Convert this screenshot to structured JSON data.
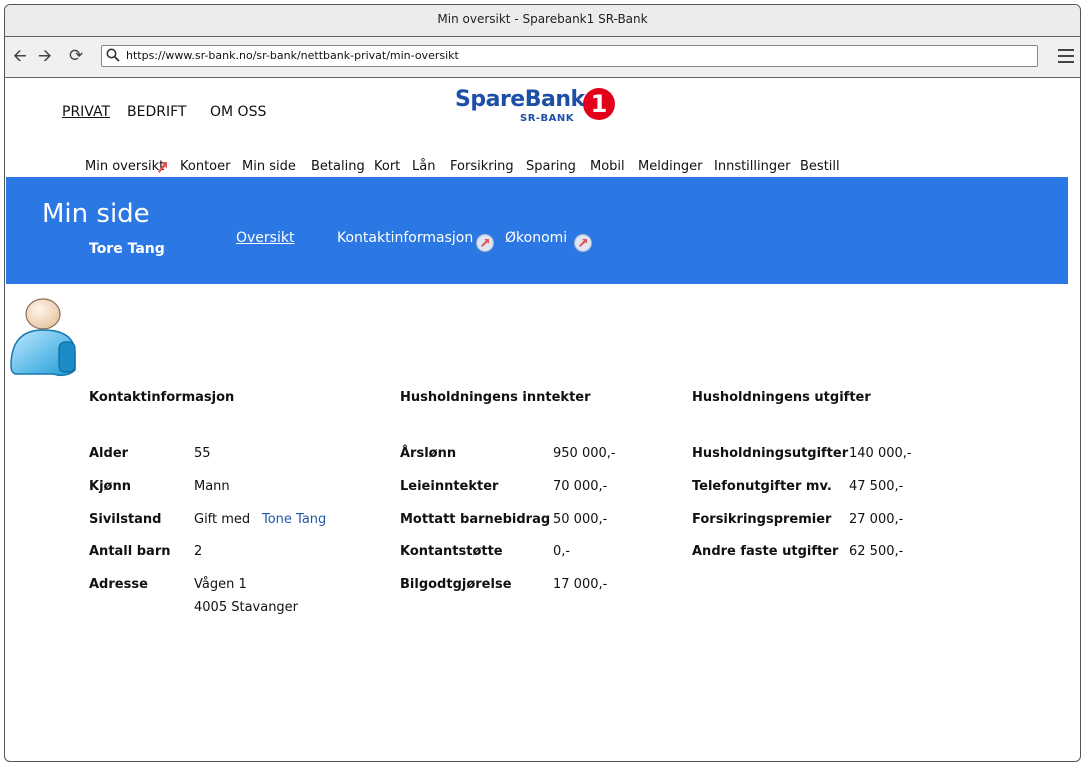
{
  "window": {
    "title": "Min oversikt - Sparebank1 SR-Bank"
  },
  "browser": {
    "url": "https://www.sr-bank.no/sr-bank/nettbank-privat/min-oversikt"
  },
  "topnav": [
    "PRIVAT",
    "BEDRIFT",
    "OM OSS"
  ],
  "logo": {
    "name": "SpareBank",
    "sub": "SR-BANK",
    "number": "1"
  },
  "menu": [
    "Min oversikt",
    "Kontoer",
    "Min side",
    "Betaling",
    "Kort",
    "Lån",
    "Forsikring",
    "Sparing",
    "Mobil",
    "Meldinger",
    "Innstillinger",
    "Bestill"
  ],
  "banner": {
    "title": "Min side",
    "user": "Tore Tang",
    "links": [
      "Oversikt",
      "Kontaktinformasjon",
      "Økonomi"
    ]
  },
  "contact": {
    "heading": "Kontaktinformasjon",
    "rows": [
      {
        "label": "Alder",
        "value": "55"
      },
      {
        "label": "Kjønn",
        "value": "Mann"
      },
      {
        "label": "Sivilstand",
        "value": "Gift med",
        "link": "Tone Tang"
      },
      {
        "label": "Antall barn",
        "value": "2"
      },
      {
        "label": "Adresse",
        "value": "Vågen 1",
        "value2": "4005 Stavanger"
      }
    ]
  },
  "income": {
    "heading": "Husholdningens inntekter",
    "rows": [
      {
        "label": "Årslønn",
        "value": "950 000,-"
      },
      {
        "label": "Leieinntekter",
        "value": "70 000,-"
      },
      {
        "label": "Mottatt barnebidrag",
        "value": "50 000,-"
      },
      {
        "label": "Kontantstøtte",
        "value": "0,-"
      },
      {
        "label": "Bilgodtgjørelse",
        "value": "17 000,-"
      }
    ]
  },
  "expenses": {
    "heading": "Husholdningens utgifter",
    "rows": [
      {
        "label": "Husholdningsutgifter",
        "value": "140 000,-"
      },
      {
        "label": "Telefonutgifter mv.",
        "value": "47 500,-"
      },
      {
        "label": "Forsikringspremier",
        "value": "27 000,-"
      },
      {
        "label": "Andre faste utgifter",
        "value": "62 500,-"
      }
    ]
  },
  "colors": {
    "banner": "#2b78e4",
    "brand": "#1e4fa7",
    "brand_red": "#e3001b",
    "link": "#1f58a8"
  }
}
